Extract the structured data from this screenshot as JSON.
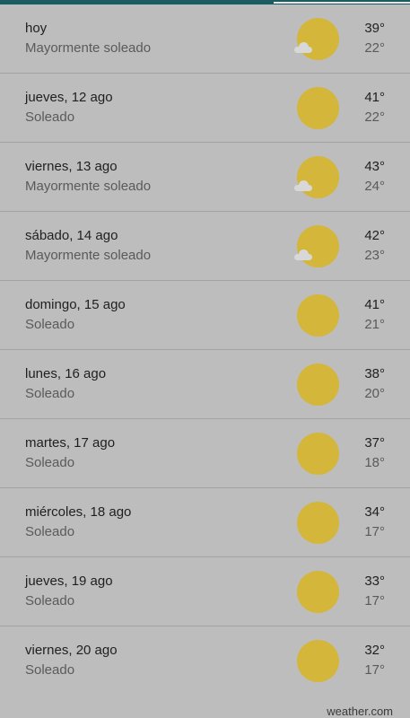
{
  "colors": {
    "background": "#bdbdbd",
    "sun": "#d3b63a",
    "topbar": "#1b5b62",
    "divider": "#a3a3a3"
  },
  "forecast": [
    {
      "day": "hoy",
      "condition": "Mayormente soleado",
      "high": "39°",
      "low": "22°",
      "icon": "mostly-sunny-icon"
    },
    {
      "day": "jueves, 12 ago",
      "condition": "Soleado",
      "high": "41°",
      "low": "22°",
      "icon": "sunny-icon"
    },
    {
      "day": "viernes, 13 ago",
      "condition": "Mayormente soleado",
      "high": "43°",
      "low": "24°",
      "icon": "mostly-sunny-icon"
    },
    {
      "day": "sábado, 14 ago",
      "condition": "Mayormente soleado",
      "high": "42°",
      "low": "23°",
      "icon": "mostly-sunny-icon"
    },
    {
      "day": "domingo, 15 ago",
      "condition": "Soleado",
      "high": "41°",
      "low": "21°",
      "icon": "sunny-icon"
    },
    {
      "day": "lunes, 16 ago",
      "condition": "Soleado",
      "high": "38°",
      "low": "20°",
      "icon": "sunny-icon"
    },
    {
      "day": "martes, 17 ago",
      "condition": "Soleado",
      "high": "37°",
      "low": "18°",
      "icon": "sunny-icon"
    },
    {
      "day": "miércoles, 18 ago",
      "condition": "Soleado",
      "high": "34°",
      "low": "17°",
      "icon": "sunny-icon"
    },
    {
      "day": "jueves, 19 ago",
      "condition": "Soleado",
      "high": "33°",
      "low": "17°",
      "icon": "sunny-icon"
    },
    {
      "day": "viernes, 20 ago",
      "condition": "Soleado",
      "high": "32°",
      "low": "17°",
      "icon": "sunny-icon"
    }
  ],
  "footer": {
    "source": "weather.com"
  }
}
